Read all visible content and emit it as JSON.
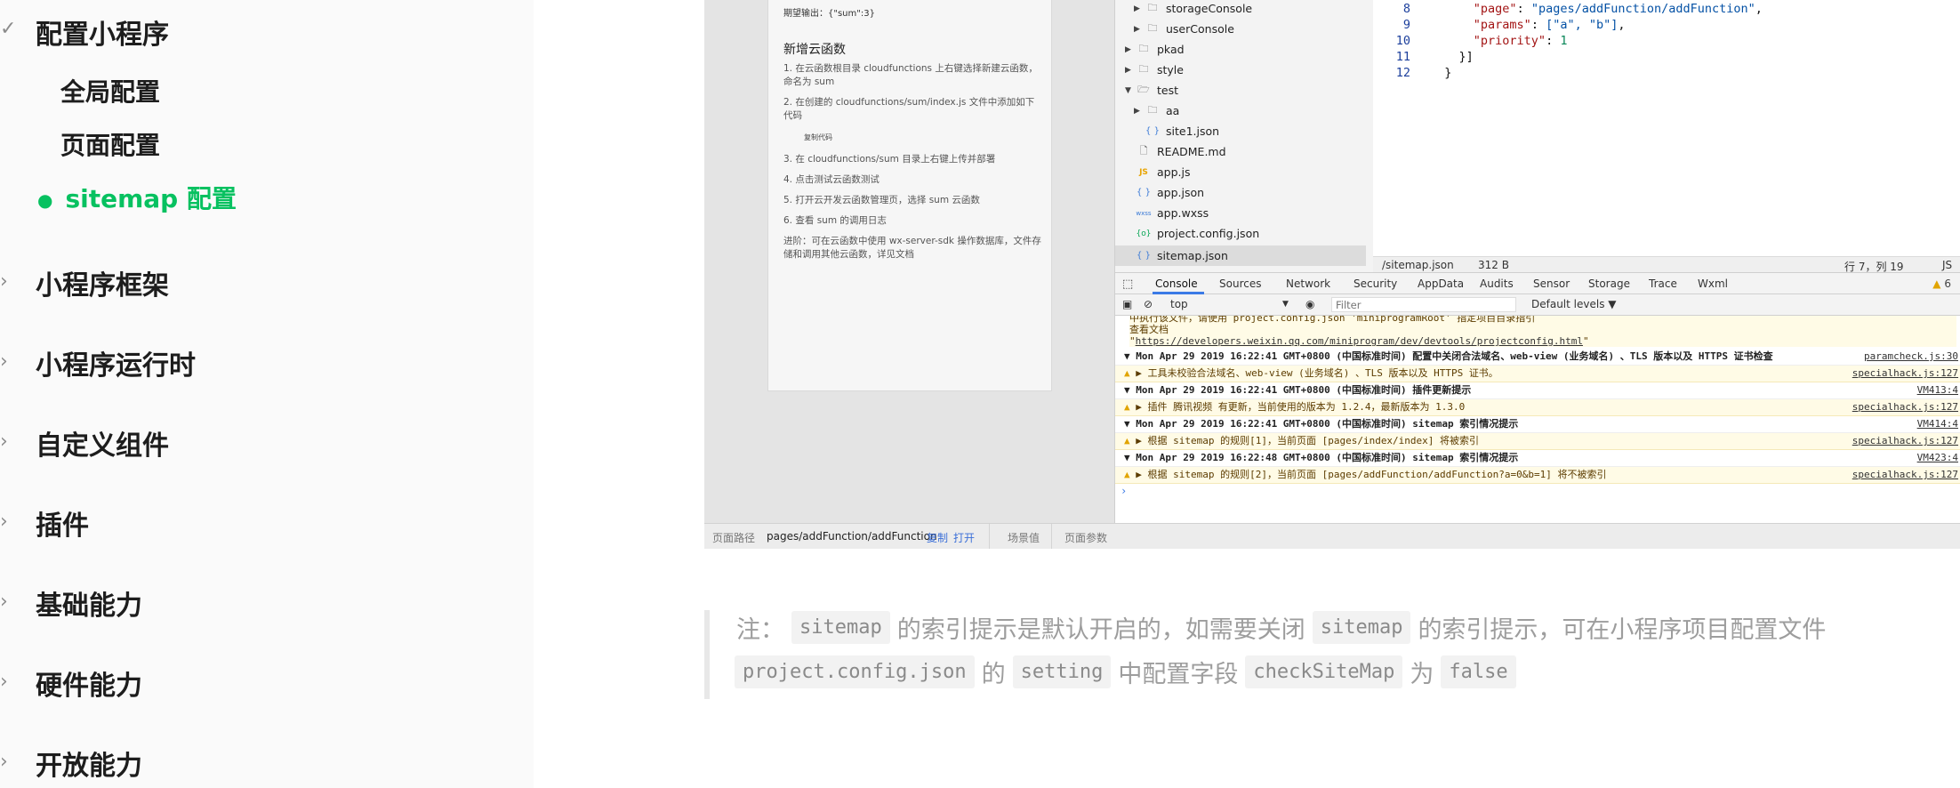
{
  "sidebar": {
    "section_title": "配置小程序",
    "section_children": [
      "全局配置",
      "页面配置"
    ],
    "active_child": "sitemap 配置",
    "groups": [
      "小程序框架",
      "小程序运行时",
      "自定义组件",
      "插件",
      "基础能力",
      "硬件能力",
      "开放能力"
    ]
  },
  "simulator": {
    "expect": "期望输出：{\"sum\":3}",
    "section_title": "新增云函数",
    "steps": [
      "1. 在云函数根目录 cloudfunctions 上右键选择新建云函数，命名为 sum",
      "2. 在创建的 cloudfunctions/sum/index.js 文件中添加如下代码",
      "3. 在 cloudfunctions/sum 目录上右键上传并部署",
      "4. 点击测试云函数测试",
      "5. 打开云开发云函数管理页，选择 sum 云函数",
      "6. 查看 sum 的调用日志",
      "进阶：可在云函数中使用 wx-server-sdk 操作数据库，文件存储和调用其他云函数，详见文档"
    ],
    "copy_label": "复制代码",
    "footer": {
      "path_label": "页面路径",
      "path_value": "pages/addFunction/addFunction",
      "copy": "复制",
      "open": "打开",
      "scene": "场景值",
      "params": "页面参数"
    }
  },
  "tree": {
    "items": [
      {
        "name": "storageConsole",
        "type": "folder"
      },
      {
        "name": "userConsole",
        "type": "folder"
      },
      {
        "name": "pkad",
        "type": "folder"
      },
      {
        "name": "style",
        "type": "folder"
      },
      {
        "name": "test",
        "type": "folder-open"
      },
      {
        "name": "aa",
        "type": "folder"
      },
      {
        "name": "site1.json",
        "type": "json"
      },
      {
        "name": "README.md",
        "type": "file"
      },
      {
        "name": "app.js",
        "type": "js"
      },
      {
        "name": "app.json",
        "type": "json"
      },
      {
        "name": "app.wxss",
        "type": "wxss"
      },
      {
        "name": "project.config.json",
        "type": "cfg"
      },
      {
        "name": "sitemap.json",
        "type": "json"
      }
    ]
  },
  "editor": {
    "lines": [
      {
        "n": "8",
        "key": "\"page\"",
        "val": "\"pages/addFunction/addFunction\"",
        "tail": ","
      },
      {
        "n": "9",
        "key": "\"params\"",
        "val": "[\"a\", \"b\"]",
        "tail": ","
      },
      {
        "n": "10",
        "key": "\"priority\"",
        "val": "1",
        "tail": ""
      },
      {
        "n": "11",
        "text": "    }]"
      },
      {
        "n": "12",
        "text": "  }"
      }
    ],
    "status": {
      "file": "/sitemap.json",
      "size": "312 B",
      "position": "行 7，列 19",
      "lang": "JS"
    }
  },
  "devtools": {
    "tabs": [
      "Console",
      "Sources",
      "Network",
      "Security",
      "AppData",
      "Audits",
      "Sensor",
      "Storage",
      "Trace",
      "Wxml"
    ],
    "warn_count": "6",
    "context": "top",
    "filter_placeholder": "Filter",
    "levels": "Default levels ▼",
    "console_pre": [
      "中执行该文件，请使用 project.config.json 'miniprogramRoot' 指定项目目录指引",
      "查看文档"
    ],
    "console_pre_link": "https://developers.weixin.qq.com/miniprogram/dev/devtools/projectconfig.html",
    "rows": [
      {
        "kind": "group",
        "text": "▼ Mon Apr 29 2019 16:22:41 GMT+0800 (中国标准时间) 配置中关闭合法域名、web-view (业务域名) 、TLS 版本以及 HTTPS 证书检查",
        "src": "paramcheck.js:30"
      },
      {
        "kind": "warn",
        "text": "▶ 工具未校验合法域名、web-view (业务域名) 、TLS 版本以及 HTTPS 证书。",
        "src": "specialhack.js:127"
      },
      {
        "kind": "group",
        "text": "▼ Mon Apr 29 2019 16:22:41 GMT+0800 (中国标准时间) 插件更新提示",
        "src": "VM413:4"
      },
      {
        "kind": "warn",
        "text": "▶ 插件 腾讯视频 有更新，当前使用的版本为 1.2.4，最新版本为 1.3.0",
        "src": "specialhack.js:127"
      },
      {
        "kind": "group",
        "text": "▼ Mon Apr 29 2019 16:22:41 GMT+0800 (中国标准时间) sitemap 索引情况提示",
        "src": "VM414:4"
      },
      {
        "kind": "warn",
        "text": "▶ 根据 sitemap 的规则[1]，当前页面 [pages/index/index] 将被索引",
        "src": "specialhack.js:127"
      },
      {
        "kind": "group",
        "text": "▼ Mon Apr 29 2019 16:22:48 GMT+0800 (中国标准时间) sitemap 索引情况提示",
        "src": "VM423:4"
      },
      {
        "kind": "warn",
        "text": "▶ 根据 sitemap 的规则[2]，当前页面 [pages/addFunction/addFunction?a=0&b=1] 将不被索引",
        "src": "specialhack.js:127"
      }
    ],
    "prompt": "›"
  },
  "note": {
    "prefix": "注：",
    "code1": "sitemap",
    "mid1": "的索引提示是默认开启的，如需要关闭",
    "code2": "sitemap",
    "mid2": "的索引提示，可在小程序项目配置文件",
    "code3": "project.config.json",
    "mid3": "的",
    "code4": "setting",
    "mid4": "中配置字段",
    "code5": "checkSiteMap",
    "mid5": "为",
    "code6": "false"
  },
  "colors": {
    "accent": "#07c160",
    "link": "#3b6fd8",
    "warn": "#e1a400"
  }
}
